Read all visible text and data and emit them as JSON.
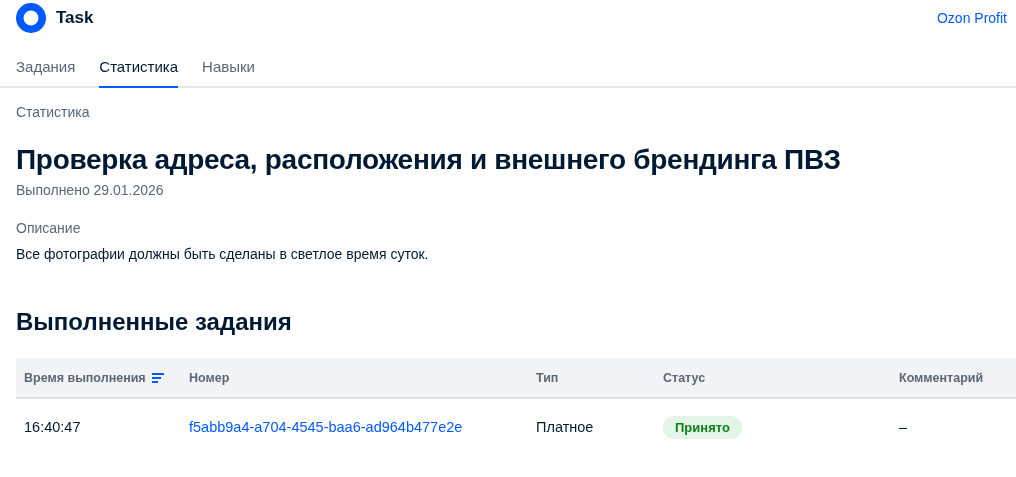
{
  "app": {
    "title": "Task",
    "link": "Ozon Profit"
  },
  "tabs": [
    {
      "label": "Задания",
      "selected": false
    },
    {
      "label": "Статистика",
      "selected": true
    },
    {
      "label": "Навыки",
      "selected": false
    }
  ],
  "breadcrumb": "Статистика",
  "task": {
    "title": "Проверка адреса, расположения и внешнего брендинга ПВЗ",
    "completed": "Выполнено 29.01.2026",
    "description_label": "Описание",
    "description": "Все фотографии должны быть сделаны в светлое время суток."
  },
  "section_title": "Выполненные задания",
  "table": {
    "columns": [
      {
        "label": "Время выполнения",
        "sortable": true
      },
      {
        "label": "Номер",
        "sortable": false
      },
      {
        "label": "Тип",
        "sortable": false
      },
      {
        "label": "Статус",
        "sortable": false
      },
      {
        "label": "Комментарий",
        "sortable": false
      }
    ],
    "rows": [
      {
        "time": "16:40:47",
        "number": "f5abb9a4-a704-4545-baa6-ad964b477e2e",
        "type": "Платное",
        "status": {
          "text": "Принято",
          "kind": "accepted"
        },
        "comment": "–"
      }
    ]
  }
}
